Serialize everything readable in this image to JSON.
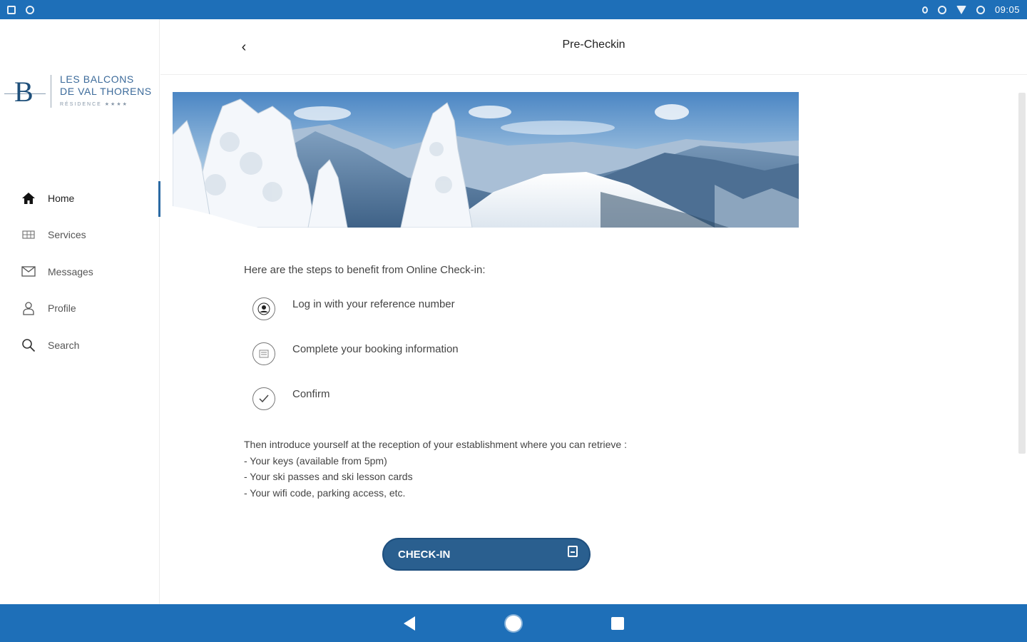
{
  "status_bar": {
    "time": "09:05"
  },
  "brand": {
    "letter": "B",
    "name_line1": "LES BALCONS",
    "name_line2": "DE VAL THORENS",
    "subtitle": "RÉSIDENCE ★★★★"
  },
  "sidebar": {
    "items": [
      {
        "label": "Home",
        "icon": "home-icon",
        "active": true
      },
      {
        "label": "Services",
        "icon": "services-icon",
        "active": false
      },
      {
        "label": "Messages",
        "icon": "mail-icon",
        "active": false
      },
      {
        "label": "Profile",
        "icon": "person-icon",
        "active": false
      },
      {
        "label": "Search",
        "icon": "search-icon",
        "active": false
      }
    ]
  },
  "header": {
    "back": "‹",
    "title": "Pre-Checkin"
  },
  "main": {
    "intro": "Here are the steps to benefit from Online Check-in:",
    "steps": [
      {
        "label": "Log in with your reference number",
        "icon": "user-icon"
      },
      {
        "label": "Complete your booking information",
        "icon": "form-icon"
      },
      {
        "label": "Confirm",
        "icon": "check-icon"
      }
    ],
    "retrieve_intro": "Then introduce yourself at the reception of your establishment where you can retrieve :",
    "retrieve_items": [
      "- Your keys (available from 5pm)",
      "- Your ski passes and ski lesson cards",
      "- Your wifi code, parking access, etc."
    ],
    "checkin_button": "CHECK-IN"
  },
  "colors": {
    "primary": "#1e6fb8",
    "button": "#2a5f8f",
    "brand_text": "#3b6a9a"
  }
}
